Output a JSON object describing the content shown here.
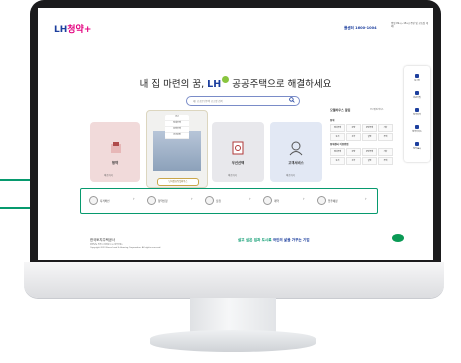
{
  "header": {
    "logo_main": "LH",
    "logo_accent": "청약+",
    "phone": "콜센터 1600-1004",
    "note": "평일 09시~18시 (주말 및 공휴일 제외)"
  },
  "hero": {
    "text_before": "내 집 마련의 꿈, ",
    "text_brand": "LH",
    "text_after": " 공공주택으로 해결하세요"
  },
  "search": {
    "placeholder": "예) 공공분양주택 공고명 검색"
  },
  "cards": {
    "subscribe": {
      "title": "청약",
      "more": "바로가기"
    },
    "complex": {
      "menu": [
        "공고",
        "임대주택",
        "분양주택",
        "공공분양"
      ],
      "pill": "단지정보/모델하우스"
    },
    "realestate": {
      "title": "우선선택",
      "more": "바로가기"
    },
    "customer": {
      "title": "고객서비스",
      "more": "바로가기"
    }
  },
  "right_panel": {
    "heading": "모델하우스 알림",
    "sub": "공고알림서비스",
    "section1": "청약",
    "grid1": [
      "임대주택",
      "분양",
      "분양주택",
      "기타",
      "토지",
      "상가",
      "설명",
      "주택"
    ],
    "section2": "청약센터 이용방법",
    "grid2": [
      "임대주택",
      "분양",
      "분양주택",
      "기타",
      "토지",
      "상가",
      "설명",
      "주택"
    ]
  },
  "side_menu": [
    "로그인",
    "회원가입",
    "청약자격",
    "청약가이드",
    "청약FAQ"
  ],
  "steps": [
    "자격확인",
    "청약신청",
    "당첨",
    "계약",
    "입주예정"
  ],
  "footer": {
    "org": "한국토지주택공사",
    "info": "경상남도 진주시 충의로 19 (충무공동)",
    "copyright": "Copyright 2023 Korea Land & Housing Corporation. All rights reserved.",
    "slogan_a": "살고 싶은 집과 도시로",
    "slogan_b": " 국민의 삶을 가꾸는 기업"
  }
}
